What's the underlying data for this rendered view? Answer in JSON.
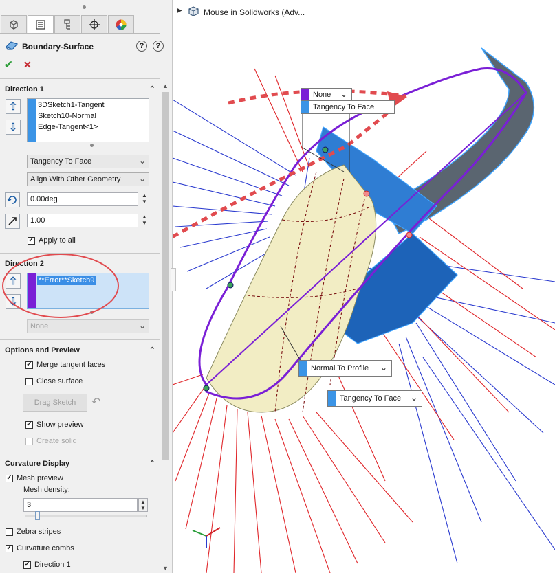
{
  "feature": {
    "title": "Boundary-Surface",
    "help_glyph": "?",
    "ok_glyph": "✔",
    "cancel_glyph": "✕"
  },
  "tabs": [
    "feature-manager-icon",
    "property-manager-icon",
    "configuration-manager-icon",
    "dim-xpert-icon",
    "display-manager-icon"
  ],
  "direction1": {
    "header": "Direction 1",
    "items": [
      "3DSketch1-Tangent",
      "Sketch10-Normal",
      "Edge-Tangent<1>"
    ],
    "tangency": "Tangency To Face",
    "alignment": "Align With Other Geometry",
    "angle": "0.00deg",
    "length": "1.00",
    "apply_to_all": "Apply to all",
    "color": "#3b94e6"
  },
  "direction2": {
    "header": "Direction 2",
    "items": [
      "**Error**Sketch9"
    ],
    "tangency": "None",
    "color": "#7a1fd6"
  },
  "options": {
    "header": "Options and Preview",
    "merge_tangent": "Merge tangent faces",
    "close_surface": "Close surface",
    "drag_sketch": "Drag Sketch",
    "show_preview": "Show preview",
    "create_solid": "Create solid"
  },
  "curvature": {
    "header": "Curvature Display",
    "mesh_preview": "Mesh preview",
    "mesh_density_label": "Mesh density:",
    "mesh_density": "3",
    "zebra": "Zebra stripes",
    "combs": "Curvature combs",
    "direction1": "Direction 1"
  },
  "tree": {
    "root": "Mouse in Solidworks  (Adv..."
  },
  "callouts": {
    "top_none": "None",
    "top_tangency": "Tangency To Face",
    "normal_profile": "Normal To Profile",
    "bottom_tangency": "Tangency To Face"
  },
  "colors": {
    "accent_blue": "#1d5fa7",
    "dir1": "#3b94e6",
    "dir2": "#7a1fd6",
    "arrow_red": "#e0393b",
    "ok_green": "#2e9e3a",
    "cancel_red": "#c4262e"
  }
}
